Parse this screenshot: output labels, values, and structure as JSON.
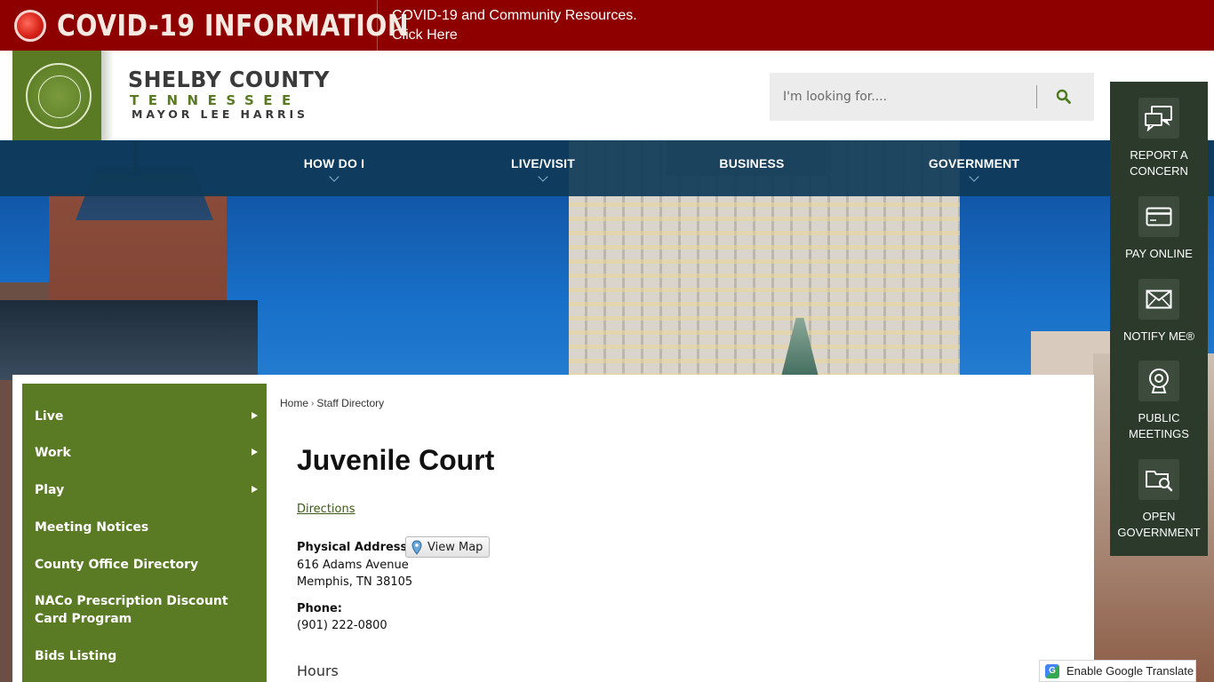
{
  "covid": {
    "title": "COVID-19 INFORMATION",
    "line1": "COVID-19 and Community Resources.",
    "line2": "Click Here"
  },
  "logo": {
    "name": "SHELBY COUNTY",
    "state": "TENNESSEE",
    "mayor": "MAYOR LEE HARRIS"
  },
  "search": {
    "placeholder": "I'm looking for...."
  },
  "nav": {
    "items": [
      {
        "label": "HOW DO I"
      },
      {
        "label": "LIVE/VISIT"
      },
      {
        "label": "BUSINESS"
      },
      {
        "label": "GOVERNMENT"
      }
    ]
  },
  "sidebar": {
    "items": [
      {
        "label": "Live"
      },
      {
        "label": "Work"
      },
      {
        "label": "Play"
      },
      {
        "label": "Meeting Notices"
      },
      {
        "label": "County Office Directory"
      },
      {
        "label": "NACo Prescription Discount Card Program"
      },
      {
        "label": "Bids Listing"
      }
    ]
  },
  "breadcrumb": {
    "home": "Home",
    "current": "Staff Directory"
  },
  "page": {
    "title": "Juvenile Court",
    "directions": "Directions",
    "address_label": "Physical Address:",
    "view_map": "View Map",
    "address_line1": "616 Adams Avenue",
    "address_line2": "Memphis, TN 38105",
    "phone_label": "Phone:",
    "phone": "(901) 222-0800",
    "hours": "Hours"
  },
  "quick_links": {
    "items": [
      {
        "label": "REPORT A CONCERN",
        "icon": "chat-bubbles-icon"
      },
      {
        "label": "PAY ONLINE",
        "icon": "credit-card-icon"
      },
      {
        "label": "NOTIFY ME®",
        "icon": "envelope-icon"
      },
      {
        "label": "PUBLIC MEETINGS",
        "icon": "webcam-icon"
      },
      {
        "label": "OPEN GOVERNMENT",
        "icon": "folder-search-icon"
      }
    ]
  },
  "translate": {
    "label": "Enable Google Translate"
  },
  "colors": {
    "covid_red": "#8e0000",
    "brand_green": "#5a7b24",
    "nav_blue": "#0e3a58",
    "quick_links_bg": "#2b3a2b"
  }
}
